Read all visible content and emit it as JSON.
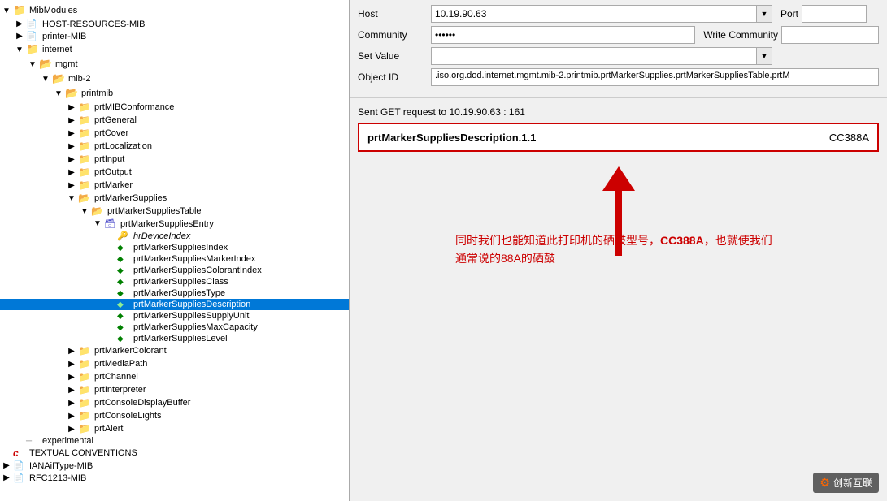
{
  "left_panel": {
    "tree": [
      {
        "id": "mib-modules",
        "label": "MibModules",
        "level": 0,
        "type": "folder",
        "expanded": true
      },
      {
        "id": "host-resources-mib",
        "label": "HOST-RESOURCES-MIB",
        "level": 0,
        "type": "mib"
      },
      {
        "id": "printer-mib",
        "label": "printer-MIB",
        "level": 0,
        "type": "mib"
      },
      {
        "id": "internet",
        "label": "internet",
        "level": 1,
        "type": "folder",
        "expanded": true
      },
      {
        "id": "mgmt",
        "label": "mgmt",
        "level": 2,
        "type": "folder-open",
        "expanded": true
      },
      {
        "id": "mib-2",
        "label": "mib-2",
        "level": 3,
        "type": "folder-open",
        "expanded": true
      },
      {
        "id": "printmib",
        "label": "printmib",
        "level": 4,
        "type": "folder-open",
        "expanded": true
      },
      {
        "id": "prtMIBConformance",
        "label": "prtMIBConformance",
        "level": 5,
        "type": "folder"
      },
      {
        "id": "prtGeneral",
        "label": "prtGeneral",
        "level": 5,
        "type": "folder"
      },
      {
        "id": "prtCover",
        "label": "prtCover",
        "level": 5,
        "type": "folder"
      },
      {
        "id": "prtLocalization",
        "label": "prtLocalization",
        "level": 5,
        "type": "folder"
      },
      {
        "id": "prtInput",
        "label": "prtInput",
        "level": 5,
        "type": "folder"
      },
      {
        "id": "prtOutput",
        "label": "prtOutput",
        "level": 5,
        "type": "folder"
      },
      {
        "id": "prtMarker",
        "label": "prtMarker",
        "level": 5,
        "type": "folder"
      },
      {
        "id": "prtMarkerSupplies",
        "label": "prtMarkerSupplies",
        "level": 5,
        "type": "folder-open",
        "expanded": true
      },
      {
        "id": "prtMarkerSuppliesTable",
        "label": "prtMarkerSuppliesTable",
        "level": 6,
        "type": "folder-open",
        "expanded": true
      },
      {
        "id": "prtMarkerSuppliesEntry",
        "label": "prtMarkerSuppliesEntry",
        "level": 7,
        "type": "folder-open",
        "expanded": true
      },
      {
        "id": "hrDeviceIndex",
        "label": "hrDeviceIndex",
        "level": 8,
        "type": "leaf-italic"
      },
      {
        "id": "prtMarkerSuppliesIndex",
        "label": "prtMarkerSuppliesIndex",
        "level": 8,
        "type": "leaf-green"
      },
      {
        "id": "prtMarkerSuppliesMarkerIndex",
        "label": "prtMarkerSuppliesMarkerIndex",
        "level": 8,
        "type": "leaf-green"
      },
      {
        "id": "prtMarkerSuppliesColorantIndex",
        "label": "prtMarkerSuppliesColorantIndex",
        "level": 8,
        "type": "leaf-green"
      },
      {
        "id": "prtMarkerSuppliesClass",
        "label": "prtMarkerSuppliesClass",
        "level": 8,
        "type": "leaf-green"
      },
      {
        "id": "prtMarkerSuppliesType",
        "label": "prtMarkerSuppliesType",
        "level": 8,
        "type": "leaf-green"
      },
      {
        "id": "prtMarkerSuppliesDescription",
        "label": "prtMarkerSuppliesDescription",
        "level": 8,
        "type": "leaf-green",
        "selected": true
      },
      {
        "id": "prtMarkerSuppliesSupplyUnit",
        "label": "prtMarkerSuppliesSupplyUnit",
        "level": 8,
        "type": "leaf-green"
      },
      {
        "id": "prtMarkerSuppliesMaxCapacity",
        "label": "prtMarkerSuppliesMaxCapacity",
        "level": 8,
        "type": "leaf-green"
      },
      {
        "id": "prtMarkerSuppliesLevel",
        "label": "prtMarkerSuppliesLevel",
        "level": 8,
        "type": "leaf-green"
      },
      {
        "id": "prtMarkerColorant",
        "label": "prtMarkerColorant",
        "level": 5,
        "type": "folder"
      },
      {
        "id": "prtMediaPath",
        "label": "prtMediaPath",
        "level": 5,
        "type": "folder"
      },
      {
        "id": "prtChannel",
        "label": "prtChannel",
        "level": 5,
        "type": "folder"
      },
      {
        "id": "prtInterpreter",
        "label": "prtInterpreter",
        "level": 5,
        "type": "folder"
      },
      {
        "id": "prtConsoleDisplayBuffer",
        "label": "prtConsoleDisplayBuffer",
        "level": 5,
        "type": "folder"
      },
      {
        "id": "prtConsoleLights",
        "label": "prtConsoleLights",
        "level": 5,
        "type": "folder"
      },
      {
        "id": "prtAlert",
        "label": "prtAlert",
        "level": 5,
        "type": "folder"
      },
      {
        "id": "experimental",
        "label": "experimental",
        "level": 1,
        "type": "leaf"
      },
      {
        "id": "textual-conventions",
        "label": "TEXTUAL CONVENTIONS",
        "level": 0,
        "type": "c-icon"
      },
      {
        "id": "ianaiftype-mib",
        "label": "IANAifType-MIB",
        "level": 0,
        "type": "mib"
      },
      {
        "id": "rfc1213-mib",
        "label": "RFC1213-MIB",
        "level": 0,
        "type": "mib"
      }
    ]
  },
  "right_panel": {
    "host_label": "Host",
    "host_value": "10.19.90.63",
    "port_label": "Port",
    "community_label": "Community",
    "community_value": "******",
    "write_community_label": "Write Community",
    "set_value_label": "Set Value",
    "set_value": "",
    "object_id_label": "Object ID",
    "object_id_value": ".iso.org.dod.internet.mgmt.mib-2.printmib.prtMarkerSupplies.prtMarkerSuppliesTable.prtM",
    "sent_info": "Sent GET request to 10.19.90.63 : 161",
    "result_key": "prtMarkerSuppliesDescription.1.1",
    "result_value": "CC388A",
    "annotation_line1": "同时我们也能知道此打印机的硒鼓型号，CC388A，也就使我们",
    "annotation_line2": "通常说的88A的硒鼓",
    "annotation_highlight": "CC388A"
  },
  "watermark": {
    "text": "创新互联",
    "icon": "⚙"
  }
}
